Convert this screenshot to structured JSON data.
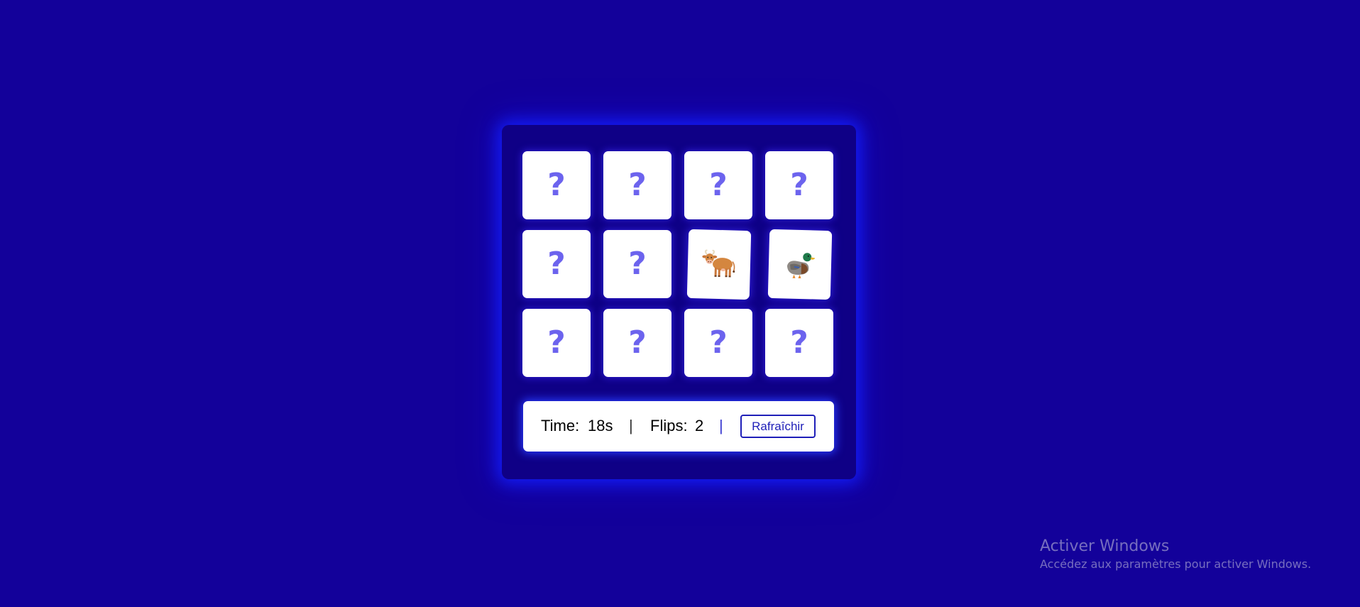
{
  "game": {
    "hidden_symbol": "?",
    "cards": [
      {
        "row": 1,
        "col": 1,
        "state": "hidden"
      },
      {
        "row": 1,
        "col": 2,
        "state": "hidden"
      },
      {
        "row": 1,
        "col": 3,
        "state": "hidden"
      },
      {
        "row": 1,
        "col": 4,
        "state": "hidden"
      },
      {
        "row": 2,
        "col": 1,
        "state": "hidden"
      },
      {
        "row": 2,
        "col": 2,
        "state": "hidden"
      },
      {
        "row": 2,
        "col": 3,
        "state": "flipped",
        "icon": "cow-icon"
      },
      {
        "row": 2,
        "col": 4,
        "state": "flipped",
        "icon": "duck-icon"
      },
      {
        "row": 3,
        "col": 1,
        "state": "hidden"
      },
      {
        "row": 3,
        "col": 2,
        "state": "hidden"
      },
      {
        "row": 3,
        "col": 3,
        "state": "hidden"
      },
      {
        "row": 3,
        "col": 4,
        "state": "hidden"
      }
    ]
  },
  "stats": {
    "time_label": "Time:",
    "time_value": "18s",
    "separator": "|",
    "flips_label": "Flips:",
    "flips_value": "2",
    "refresh_label": "Rafraîchir"
  },
  "watermark": {
    "title": "Activer Windows",
    "subtitle": "Accédez aux paramètres pour activer Windows."
  },
  "colors": {
    "background": "#13019a",
    "board": "#0f0086",
    "question_mark": "#6c63ee",
    "glow": "#1428ff",
    "button_accent": "#1f1fb8"
  }
}
